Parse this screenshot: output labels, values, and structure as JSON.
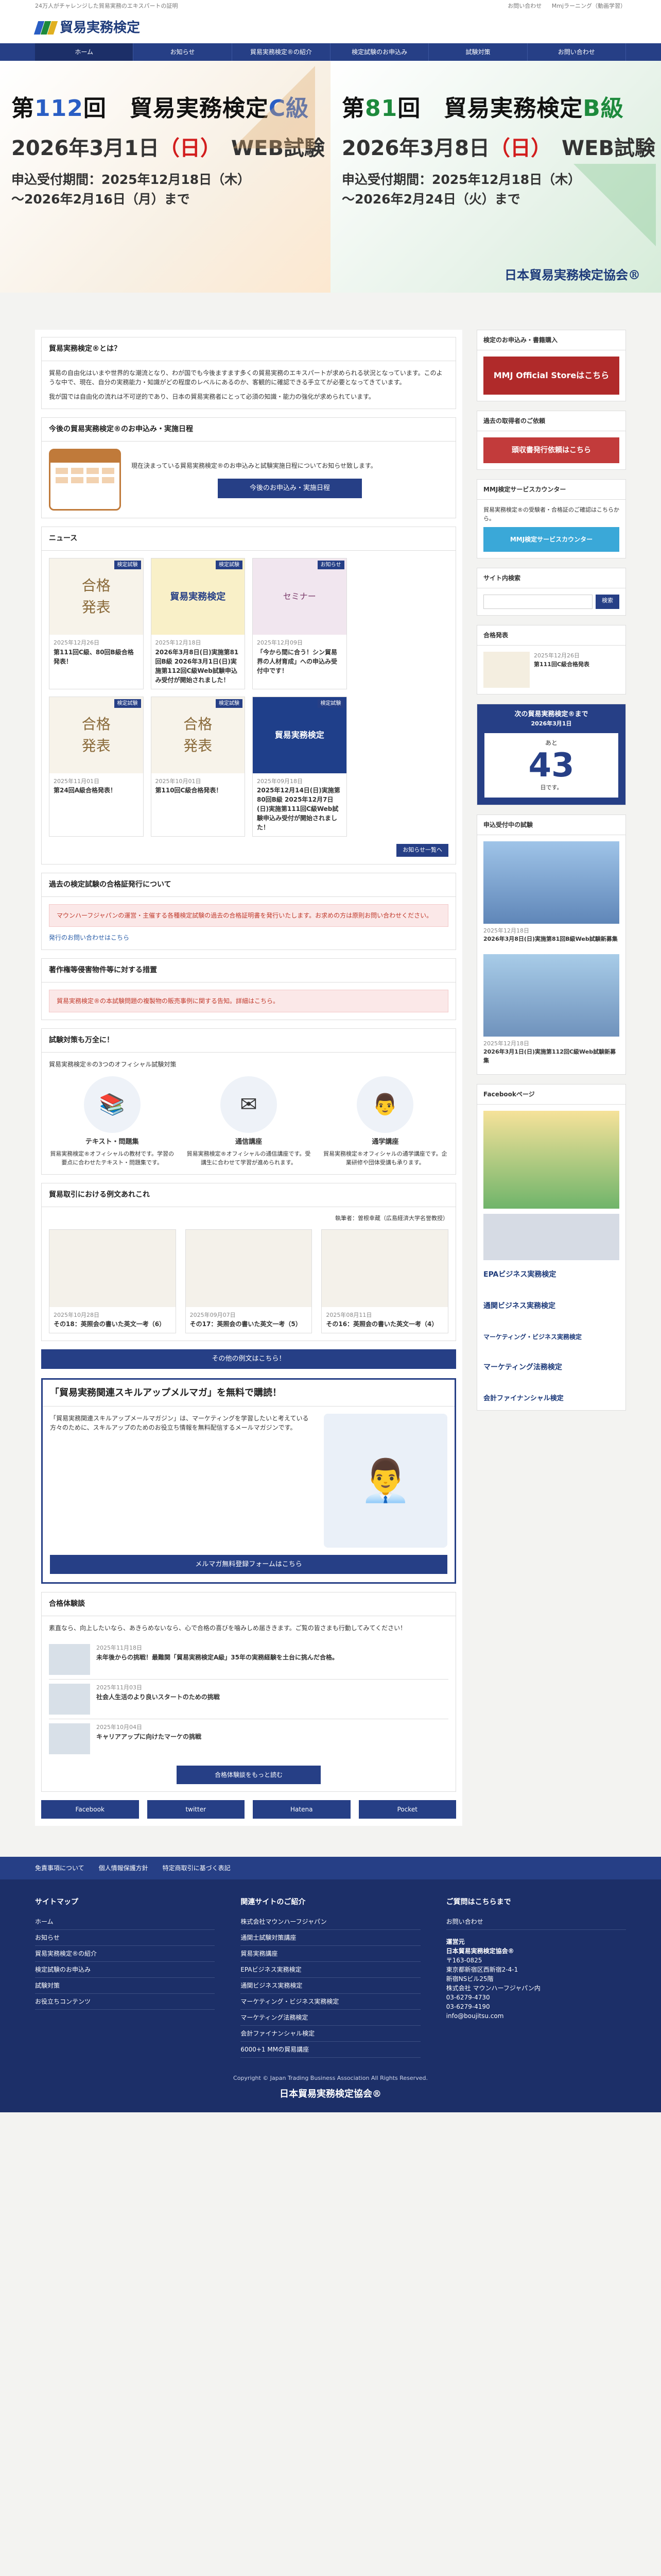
{
  "topline": {
    "tagline": "24万人がチャレンジした貿易実務のエキスパートの証明",
    "link1": "お問い合わせ",
    "link2": "Mmjラーニング（動画学習）"
  },
  "logo": {
    "text": "貿易実務検定"
  },
  "nav": [
    "ホーム",
    "お知らせ",
    "貿易実務検定®の紹介",
    "検定試験のお申込み",
    "試験対策",
    "お問い合わせ"
  ],
  "hero": {
    "left": {
      "kai_pre": "第",
      "num": "112",
      "kai_post": "回　貿易実務検定",
      "cls": "C級",
      "date": "2026年3月1日",
      "day": "（日）",
      "web": "WEB試験",
      "acc1": "申込受付期間：2025年12月18日（木）",
      "acc2": "〜2026年2月16日（月）まで"
    },
    "right": {
      "kai_pre": "第",
      "num": "81",
      "kai_post": "回　貿易実務検定",
      "cls": "B級",
      "date": "2026年3月8日",
      "day": "（日）",
      "web": "WEB試験",
      "acc1": "申込受付期間：2025年12月18日（木）",
      "acc2": "〜2026年2月24日（火）まで"
    },
    "org": "日本貿易実務検定協会®"
  },
  "about": {
    "title": "貿易実務検定®とは？",
    "text": "貿易の自由化はいまや世界的な潮流となり、わが国でも今後ますます多くの貿易実務のエキスパートが求められる状況となっています。このような中で、現在、自分の実務能力・知識がどの程度のレベルにあるのか、客観的に確認できる手立てが必要となってきています。",
    "text2": "我が国では自由化の流れは不可逆的であり、日本の貿易実務者にとって必須の知識・能力の強化が求められています。"
  },
  "schedule": {
    "title": "今後の貿易実務検定®のお申込み・実施日程",
    "text": "現在決まっている貿易実務検定®のお申込みと試験実施日程についてお知らせ致します。",
    "btn": "今後のお申込み・実施日程"
  },
  "news": {
    "title": "ニュース",
    "items": [
      {
        "tag": "検定試験",
        "date": "2025年12月26日",
        "title": "第111回C級、80回B級合格発表！"
      },
      {
        "tag": "検定試験",
        "date": "2025年12月18日",
        "title": "2026年3月8日(日)実施第81回B級 2026年3月1日(日)実施第112回C級Web試験申込み受付が開始されました！"
      },
      {
        "tag": "お知らせ",
        "date": "2025年12月09日",
        "title": "「今から間に合う！シン貿易界の人材育成」への申込み受付中です！"
      },
      {
        "tag": "検定試験",
        "date": "2025年11月01日",
        "title": "第24回A級合格発表！"
      },
      {
        "tag": "検定試験",
        "date": "2025年10月01日",
        "title": "第110回C級合格発表！"
      },
      {
        "tag": "検定試験",
        "date": "2025年09月18日",
        "title": "2025年12月14日(日)実施第80回B級 2025年12月7日(日)実施第111回C級Web試験申込み受付が開始されました！"
      }
    ],
    "more": "お知らせ一覧へ"
  },
  "pastexam": {
    "title": "過去の検定試験の合格証発行について",
    "text": "マウンハーフジャパンの運営・主催する各種検定試験の過去の合格証明書を発行いたします。お求めの方は原則お問い合わせください。",
    "link": "発行のお問い合わせはこちら"
  },
  "copyright": {
    "title": "著作権等侵害物件等に対する措置",
    "text": "貿易実務検定®の本試験問題の複製物の販売事例に関する告知。詳細はこちら。"
  },
  "measures": {
    "title": "試験対策も万全に！",
    "intro": "貿易実務検定®の3つのオフィシャル試験対策",
    "items": [
      {
        "t": "テキスト・問題集",
        "d": "貿易実務検定®オフィシャルの教材です。学習の要点に合わせたテキスト・問題集です。"
      },
      {
        "t": "通信講座",
        "d": "貿易実務検定®オフィシャルの通信講座です。受講生に合わせて学習が進められます。"
      },
      {
        "t": "通学講座",
        "d": "貿易実務検定®オフィシャルの通学講座です。企業研修や団体受講も承ります。"
      }
    ]
  },
  "trade": {
    "title": "貿易取引における例文あれこれ",
    "writer": "執筆者：曽根幸蔵（広島経済大学名誉教授）",
    "items": [
      {
        "date": "2025年10月28日",
        "title": "その18：英照会の書いた英文一考（6）"
      },
      {
        "date": "2025年09月07日",
        "title": "その17：英照会の書いた英文一考（5）"
      },
      {
        "date": "2025年08月11日",
        "title": "その16：英照会の書いた英文一考（4）"
      }
    ],
    "more": "その他の例文はこちら！"
  },
  "mail": {
    "title": "「貿易実務関連スキルアップメルマガ」を無料で購読！",
    "text": "「貿易実務関連スキルアップメールマガジン」は、マーケティングを学習したいと考えている方々のために、スキルアップのためのお役立ち情報を無料配信するメールマガジンです。",
    "btn": "メルマガ無料登録フォームはこちら"
  },
  "voice": {
    "title": "合格体験談",
    "intro": "素直なら、向上したいなら、あきらめないなら、心で合格の喜びを噛みしめ届ききます。ご覧の皆さまも行動してみてください！",
    "items": [
      {
        "date": "2025年11月18日",
        "title": "未年後からの挑戦！最難関「貿易実務検定A級」35年の実務経験を土台に挑んだ合格。"
      },
      {
        "date": "2025年11月03日",
        "title": "社会人生活のより良いスタートのための挑戦"
      },
      {
        "date": "2025年10月04日",
        "title": "キャリアアップに向けたマーケの挑戦"
      }
    ],
    "more": "合格体験談をもっと読む"
  },
  "share": [
    "Facebook",
    "twitter",
    "Hatena",
    "Pocket"
  ],
  "side": {
    "apply": "検定のお申込み・書籍購入",
    "store": "MMJ Official Storeはこちら",
    "pastexam": "過去の取得者のご依頼",
    "pastbtn": "頭収書発行依頼はこちら",
    "mmj": "MMJ検定サービスカウンター",
    "mmjtext": "貿易実務検定®の受験者・合格証のご確認はこちらから。",
    "mmjbtn": "MMJ検定サービスカウンター",
    "search": "サイト内検索",
    "searchbtn": "検索",
    "pass": "合格発表",
    "passdate": "2025年12月26日",
    "passtitle": "第111回C級合格発表",
    "count": "次の貿易実務検定®まで",
    "countdate": "2026年3月1日",
    "ato": "あと",
    "days": "43",
    "unit": "日です。",
    "open": "申込受付中の試験",
    "o1date": "2025年12月18日",
    "o1": "2026年3月8日(日)実施第81回B級Web試験新募集",
    "o2date": "2025年12月18日",
    "o2": "2026年3月1日(日)実施第112回C級Web試験新募集",
    "fb": "Facebookページ",
    "banners": [
      "EPAビジネス実務検定",
      "通関ビジネス実務検定",
      "マーケティング・ビジネス実務検定",
      "マーケティング法務検定",
      "会計ファイナンシャル検定"
    ]
  },
  "foottop": [
    "免責事項について",
    "個人情報保護方針",
    "特定商取引に基づく表記"
  ],
  "footer": {
    "c1t": "サイトマップ",
    "c1": [
      "ホーム",
      "お知らせ",
      "貿易実務検定®の紹介",
      "検定試験のお申込み",
      "試験対策",
      "お役立ちコンテンツ"
    ],
    "c2t": "関連サイトのご紹介",
    "c2": [
      "株式会社マウンハーフジャパン",
      "通関士試験対策講座",
      "貿易実務講座",
      "EPAビジネス実務検定",
      "通関ビジネス実務検定",
      "マーケティング・ビジネス実務検定",
      "マーケティング法務検定",
      "会計ファイナンシャル検定",
      "6000+1 MMの貿易講座"
    ],
    "c3t": "ご質問はこちらまで",
    "c3a": "お問い合わせ",
    "c3b": "運営元",
    "org": "日本貿易実務検定協会®",
    "addr": "〒163-0825",
    "addr2": "東京都新宿区西新宿2-4-1",
    "addr3": "新宿NSビル25階",
    "company": "株式会社 マウンハーフジャパン内",
    "tel": "03-6279-4730",
    "fax": "03-6279-4190",
    "mail": "info@boujitsu.com"
  },
  "copyline": "Copyright © Japan Trading Business Association All Rights Reserved.",
  "colors": {
    "navy": "#263f86",
    "red": "#d21d1d"
  }
}
